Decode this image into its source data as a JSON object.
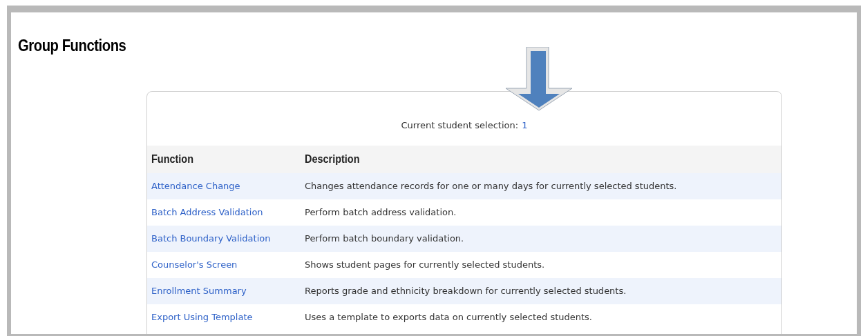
{
  "title": "Group Functions",
  "selection": {
    "label": "Current student selection:",
    "count": "1"
  },
  "table": {
    "columns": [
      "Function",
      "Description"
    ],
    "rows": [
      {
        "function": "Attendance Change",
        "description": "Changes attendance records for one or many days for currently selected students."
      },
      {
        "function": "Batch Address Validation",
        "description": "Perform batch address validation."
      },
      {
        "function": "Batch Boundary Validation",
        "description": "Perform batch boundary validation."
      },
      {
        "function": "Counselor's Screen",
        "description": "Shows student pages for currently selected students."
      },
      {
        "function": "Enrollment Summary",
        "description": "Reports grade and ethnicity breakdown for currently selected students."
      },
      {
        "function": "Export Using Template",
        "description": "Uses a template to exports data on currently selected students."
      }
    ]
  }
}
